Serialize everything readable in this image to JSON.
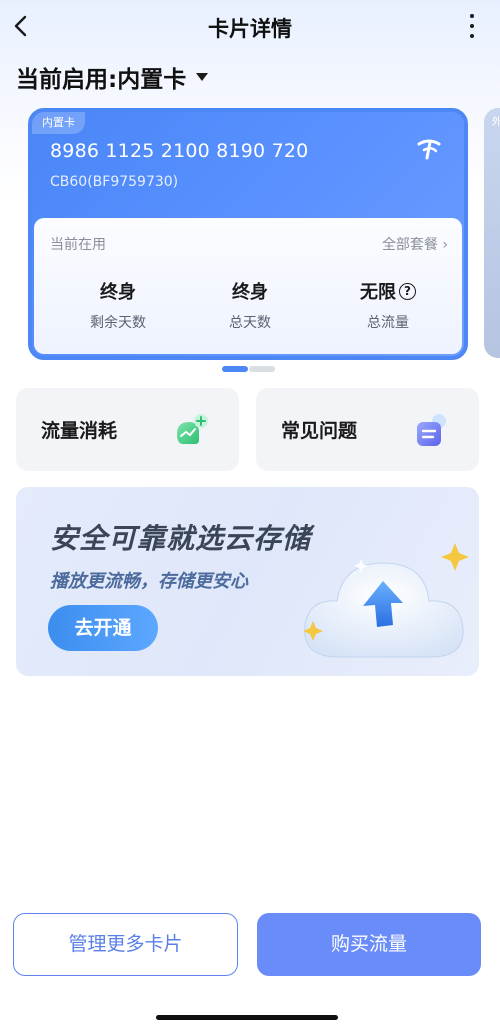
{
  "header": {
    "title": "卡片详情",
    "back_icon": "chevron-left-icon",
    "more_icon": "more-vertical-icon"
  },
  "selector": {
    "label": "当前启用:内置卡",
    "icon": "caret-down-icon"
  },
  "card": {
    "tag": "内置卡",
    "number": "8986 1125 2100 8190 720",
    "code": "CB60(BF9759730)",
    "logo": "telecom-logo-icon",
    "in_use_label": "当前在用",
    "all_plans_label": "全部套餐",
    "stats": [
      {
        "value": "终身",
        "label": "剩余天数"
      },
      {
        "value": "终身",
        "label": "总天数"
      },
      {
        "value": "无限",
        "label": "总流量"
      }
    ],
    "accent": "#4c87f5"
  },
  "next_card_tag": "外",
  "pager": {
    "current": 1,
    "total": 2
  },
  "tiles": [
    {
      "label": "流量消耗",
      "icon": "data-usage-icon"
    },
    {
      "label": "常见问题",
      "icon": "faq-icon"
    }
  ],
  "banner": {
    "headline": "安全可靠就选云存储",
    "subline": "播放更流畅，存储更安心",
    "button": "去开通",
    "art": "cloud-upload-icon"
  },
  "footer": {
    "manage_label": "管理更多卡片",
    "buy_label": "购买流量",
    "primary_color": "#6a8cf8"
  }
}
